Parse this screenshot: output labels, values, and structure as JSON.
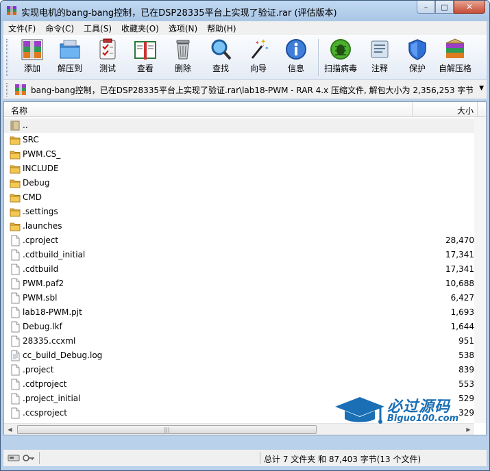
{
  "window": {
    "title": "实现电机的bang-bang控制，已在DSP28335平台上实现了验证.rar (评估版本)",
    "buttons": {
      "minimize": "–",
      "maximize": "□",
      "close": "✕"
    }
  },
  "menu": [
    "文件(F)",
    "命令(C)",
    "工具(S)",
    "收藏夹(O)",
    "选项(N)",
    "帮助(H)"
  ],
  "toolbar": [
    {
      "label": "添加",
      "icon": "add-archive-icon"
    },
    {
      "label": "解压到",
      "icon": "extract-to-icon"
    },
    {
      "label": "测试",
      "icon": "test-icon"
    },
    {
      "label": "查看",
      "icon": "view-icon"
    },
    {
      "label": "删除",
      "icon": "delete-icon"
    },
    {
      "label": "查找",
      "icon": "find-icon"
    },
    {
      "label": "向导",
      "icon": "wizard-icon"
    },
    {
      "label": "信息",
      "icon": "info-icon"
    },
    {
      "label": "扫描病毒",
      "icon": "virus-scan-icon"
    },
    {
      "label": "注释",
      "icon": "comment-icon"
    },
    {
      "label": "保护",
      "icon": "protect-icon"
    },
    {
      "label": "自解压格",
      "icon": "sfx-icon"
    }
  ],
  "address": {
    "path": "bang-bang控制，已在DSP28335平台上实现了验证.rar\\lab18-PWM - RAR 4.x 压缩文件, 解包大小为 2,356,253 字节"
  },
  "columns": {
    "name": "名称",
    "size": "大小"
  },
  "files": [
    {
      "name": "..",
      "size": "",
      "type": "parent"
    },
    {
      "name": "SRC",
      "size": "",
      "type": "folder"
    },
    {
      "name": "PWM.CS_",
      "size": "",
      "type": "folder"
    },
    {
      "name": "INCLUDE",
      "size": "",
      "type": "folder"
    },
    {
      "name": "Debug",
      "size": "",
      "type": "folder"
    },
    {
      "name": "CMD",
      "size": "",
      "type": "folder"
    },
    {
      "name": ".settings",
      "size": "",
      "type": "folder"
    },
    {
      "name": ".launches",
      "size": "",
      "type": "folder"
    },
    {
      "name": ".cproject",
      "size": "28,470",
      "type": "file"
    },
    {
      "name": ".cdtbuild_initial",
      "size": "17,341",
      "type": "file"
    },
    {
      "name": ".cdtbuild",
      "size": "17,341",
      "type": "file"
    },
    {
      "name": "PWM.paf2",
      "size": "10,688",
      "type": "file"
    },
    {
      "name": "PWM.sbl",
      "size": "6,427",
      "type": "file"
    },
    {
      "name": "lab18-PWM.pjt",
      "size": "1,693",
      "type": "file"
    },
    {
      "name": "Debug.lkf",
      "size": "1,644",
      "type": "file"
    },
    {
      "name": "28335.ccxml",
      "size": "951",
      "type": "file"
    },
    {
      "name": "cc_build_Debug.log",
      "size": "538",
      "type": "textfile"
    },
    {
      "name": ".project",
      "size": "839",
      "type": "file"
    },
    {
      "name": ".cdtproject",
      "size": "553",
      "type": "file"
    },
    {
      "name": ".project_initial",
      "size": "529",
      "type": "file"
    },
    {
      "name": ".ccsproject",
      "size": "329",
      "type": "file"
    }
  ],
  "status": {
    "summary": "总计 7 文件夹 和 87,403 字节(13 个文件)"
  },
  "watermark": {
    "cn": "必过源码",
    "en": "Biguo100.com"
  },
  "colors": {
    "folder": "#e8b43a",
    "title_bar": "#b9d1ea",
    "watermark": "#1a6fb5"
  }
}
